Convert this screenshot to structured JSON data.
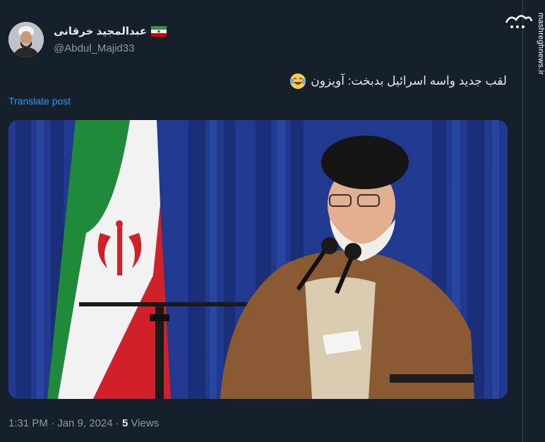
{
  "author": {
    "display_name": "عبدالمجید خرقانی",
    "handle": "@Abdul_Majid33",
    "flag_icon": "iran-flag-emoji"
  },
  "tweet": {
    "text": "لقب جدید واسه اسرائیل بدبخت: آویزون",
    "emoji": "face-with-tears-of-joy-emoji",
    "translate_label": "Translate post"
  },
  "meta": {
    "time": "1:31 PM",
    "separator": " · ",
    "date": "Jan 9, 2024",
    "views_count": "5",
    "views_label": " Views"
  },
  "watermark": {
    "url": "mashreghnews.ir",
    "logo_text": "مشرق"
  },
  "colors": {
    "background": "#15202b",
    "link": "#1d9bf0",
    "secondary_text": "#8b98a5"
  }
}
